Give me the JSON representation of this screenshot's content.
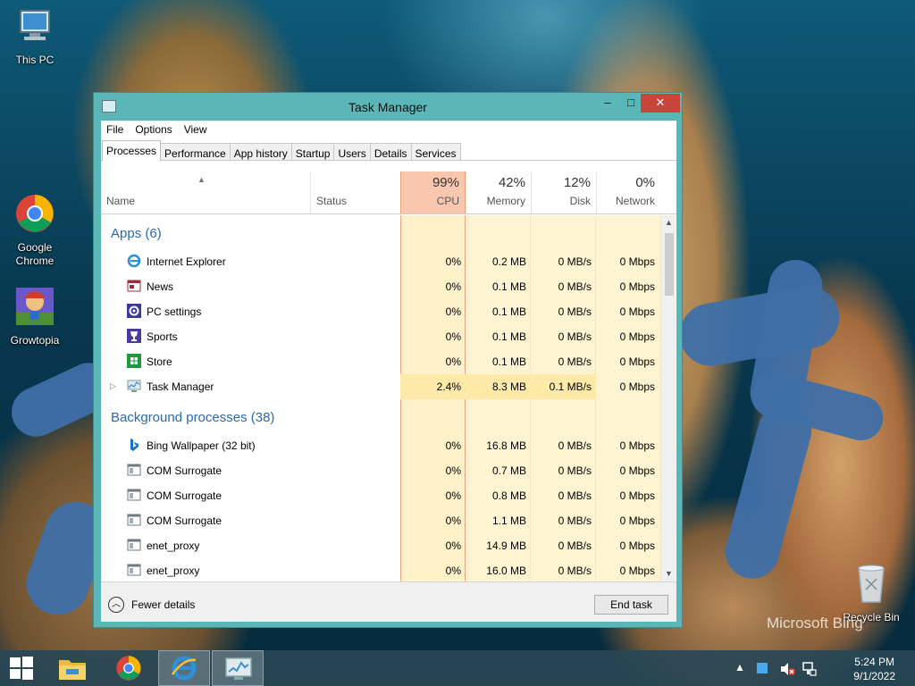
{
  "desktop": {
    "icons": [
      {
        "label": "This PC",
        "icon": "computer-icon"
      },
      {
        "label": "Google Chrome",
        "icon": "chrome-icon"
      },
      {
        "label": "Growtopia",
        "icon": "growtopia-icon"
      },
      {
        "label": "Recycle Bin",
        "icon": "recycle-bin-icon"
      }
    ],
    "watermark": "Microsoft Bing"
  },
  "window": {
    "title": "Task Manager",
    "controls": {
      "minimize": "–",
      "maximize": "□",
      "close": "✕"
    },
    "menu": [
      "File",
      "Options",
      "View"
    ],
    "tabs": [
      "Processes",
      "Performance",
      "App history",
      "Startup",
      "Users",
      "Details",
      "Services"
    ],
    "active_tab": "Processes",
    "columns": {
      "name": "Name",
      "status": "Status",
      "cpu": {
        "pct": "99%",
        "label": "CPU"
      },
      "memory": {
        "pct": "42%",
        "label": "Memory"
      },
      "disk": {
        "pct": "12%",
        "label": "Disk"
      },
      "network": {
        "pct": "0%",
        "label": "Network"
      }
    },
    "groups": {
      "apps": "Apps (6)",
      "background": "Background processes (38)"
    },
    "apps": [
      {
        "name": "Internet Explorer",
        "icon": "internet-explorer-icon",
        "cpu": "0%",
        "memory": "0.2 MB",
        "disk": "0 MB/s",
        "network": "0 Mbps"
      },
      {
        "name": "News",
        "icon": "news-icon",
        "cpu": "0%",
        "memory": "0.1 MB",
        "disk": "0 MB/s",
        "network": "0 Mbps"
      },
      {
        "name": "PC settings",
        "icon": "gear-icon",
        "cpu": "0%",
        "memory": "0.1 MB",
        "disk": "0 MB/s",
        "network": "0 Mbps"
      },
      {
        "name": "Sports",
        "icon": "trophy-icon",
        "cpu": "0%",
        "memory": "0.1 MB",
        "disk": "0 MB/s",
        "network": "0 Mbps"
      },
      {
        "name": "Store",
        "icon": "store-icon",
        "cpu": "0%",
        "memory": "0.1 MB",
        "disk": "0 MB/s",
        "network": "0 Mbps"
      },
      {
        "name": "Task Manager",
        "icon": "task-manager-icon",
        "cpu": "2.4%",
        "memory": "8.3 MB",
        "disk": "0.1 MB/s",
        "network": "0 Mbps"
      }
    ],
    "background": [
      {
        "name": "Bing Wallpaper (32 bit)",
        "icon": "bing-icon",
        "cpu": "0%",
        "memory": "16.8 MB",
        "disk": "0 MB/s",
        "network": "0 Mbps"
      },
      {
        "name": "COM Surrogate",
        "icon": "process-icon",
        "cpu": "0%",
        "memory": "0.7 MB",
        "disk": "0 MB/s",
        "network": "0 Mbps"
      },
      {
        "name": "COM Surrogate",
        "icon": "process-icon",
        "cpu": "0%",
        "memory": "0.8 MB",
        "disk": "0 MB/s",
        "network": "0 Mbps"
      },
      {
        "name": "COM Surrogate",
        "icon": "process-icon",
        "cpu": "0%",
        "memory": "1.1 MB",
        "disk": "0 MB/s",
        "network": "0 Mbps"
      },
      {
        "name": "enet_proxy",
        "icon": "process-icon",
        "cpu": "0%",
        "memory": "14.9 MB",
        "disk": "0 MB/s",
        "network": "0 Mbps"
      },
      {
        "name": "enet_proxy",
        "icon": "process-icon",
        "cpu": "0%",
        "memory": "16.0 MB",
        "disk": "0 MB/s",
        "network": "0 Mbps"
      }
    ],
    "footer": {
      "fewer_details": "Fewer details",
      "end_task": "End task"
    }
  },
  "taskbar": {
    "pinned": [
      "start-icon",
      "file-explorer-icon",
      "chrome-icon",
      "internet-explorer-icon",
      "task-manager-icon"
    ],
    "clock": {
      "time": "5:24 PM",
      "date": "9/1/2022"
    }
  }
}
